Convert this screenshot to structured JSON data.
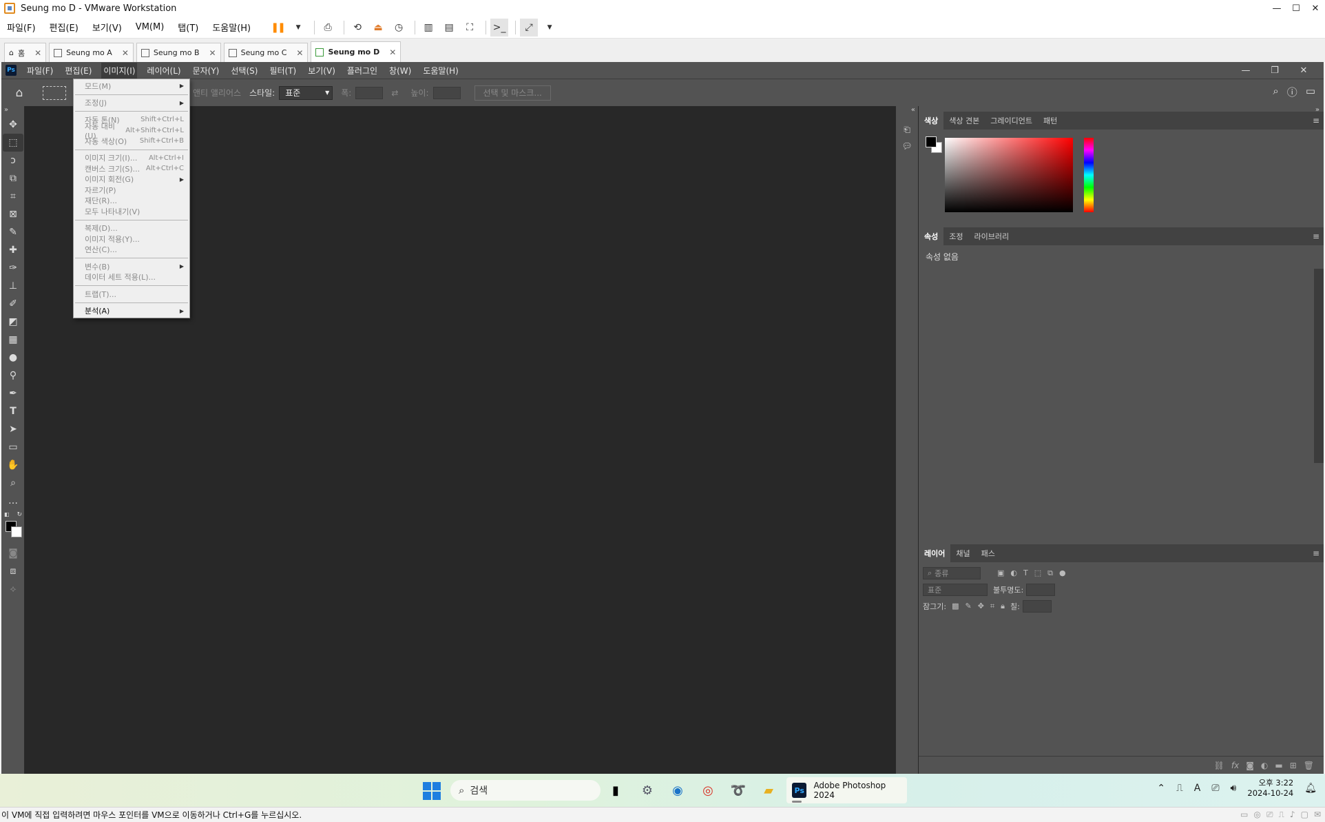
{
  "vmware": {
    "title": "Seung mo D - VMware Workstation",
    "menu": [
      "파일(F)",
      "편집(E)",
      "보기(V)",
      "VM(M)",
      "탭(T)",
      "도움말(H)"
    ],
    "tabs": [
      "홈",
      "Seung mo A",
      "Seung mo B",
      "Seung mo C",
      "Seung mo D"
    ],
    "active_tab": "Seung mo D",
    "status_text": "이 VM에 직접 입력하려면 마우스 포인터를 VM으로 이동하거나 Ctrl+G를 누르십시오."
  },
  "photoshop": {
    "menu": [
      "파일(F)",
      "편집(E)",
      "이미지(I)",
      "레이어(L)",
      "문자(Y)",
      "선택(S)",
      "필터(T)",
      "보기(V)",
      "플러그인",
      "창(W)",
      "도움말(H)"
    ],
    "open_menu": "이미지(I)",
    "options": {
      "anti_alias": "앤티 앨리어스",
      "style_label": "스타일:",
      "style_value": "표준",
      "width_label": "폭:",
      "height_label": "높이:",
      "select_mask": "선택 및 마스크..."
    },
    "image_menu": {
      "mode": "모드(M)",
      "adjust": "조정(J)",
      "auto_tone": "자동 톤(N)",
      "auto_tone_sc": "Shift+Ctrl+L",
      "auto_contrast": "자동 대비(U)",
      "auto_contrast_sc": "Alt+Shift+Ctrl+L",
      "auto_color": "자동 색상(O)",
      "auto_color_sc": "Shift+Ctrl+B",
      "image_size": "이미지 크기(I)...",
      "image_size_sc": "Alt+Ctrl+I",
      "canvas_size": "캔버스 크기(S)...",
      "canvas_size_sc": "Alt+Ctrl+C",
      "rotate": "이미지 회전(G)",
      "crop": "자르기(P)",
      "trim": "재단(R)...",
      "reveal_all": "모두 나타내기(V)",
      "duplicate": "복제(D)...",
      "apply_image": "이미지 적용(Y)...",
      "calculations": "연산(C)...",
      "variables": "변수(B)",
      "apply_data_set": "데이터 세트 적용(L)...",
      "trap": "트랩(T)...",
      "analysis": "분석(A)"
    },
    "color_panel_tabs": [
      "색상",
      "색상 견본",
      "그레이디언트",
      "패턴"
    ],
    "props_panel_tabs": [
      "속성",
      "조정",
      "라이브러리"
    ],
    "props_empty": "속성 없음",
    "layers_panel_tabs": [
      "레이어",
      "채널",
      "패스"
    ],
    "layers": {
      "kind_placeholder": "종류",
      "blend_mode": "표준",
      "opacity_label": "불투명도:",
      "lock_label": "잠그기:",
      "fill_label": "칠:"
    }
  },
  "taskbar": {
    "search_placeholder": "검색",
    "ps_app_label": "Adobe Photoshop 2024",
    "time": "오후 3:22",
    "date": "2024-10-24"
  }
}
